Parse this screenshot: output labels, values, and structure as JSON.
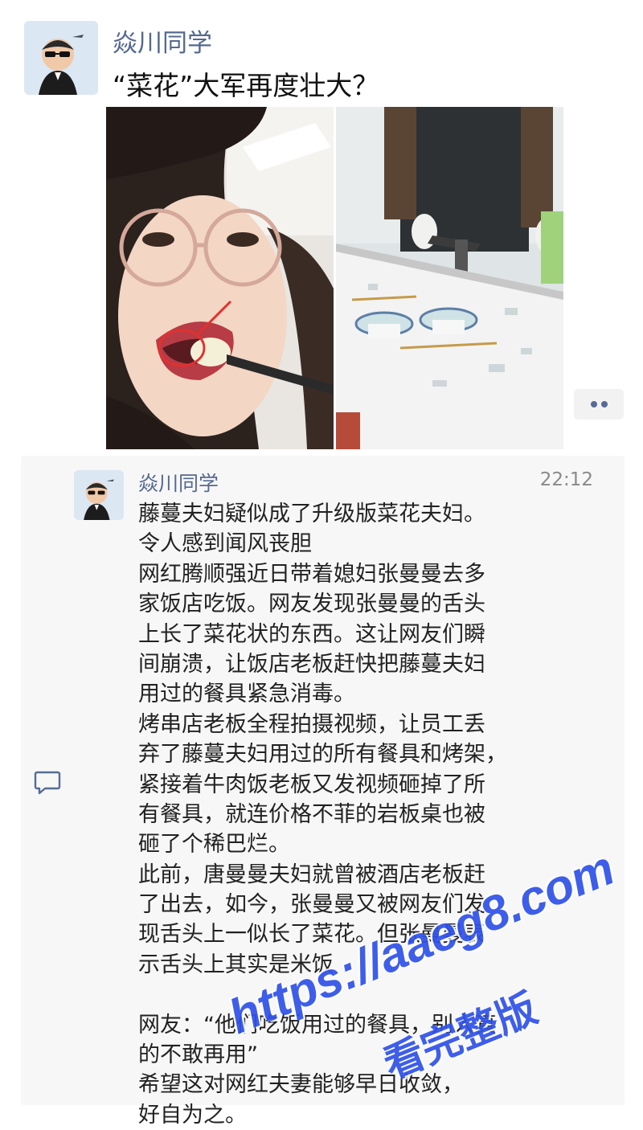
{
  "post": {
    "author": "焱川同学",
    "title": "“菜花”大军再度壮大？"
  },
  "photos": [
    {
      "icon": "woman-eating-photo"
    },
    {
      "icon": "smashed-table-photo"
    }
  ],
  "more_icon": "more-dots-icon",
  "comment": {
    "author": "焱川同学",
    "time": "22:12",
    "lines": [
      "藤蔓夫妇疑似成了升级版菜花夫妇。",
      "令人感到闻风丧胆",
      "网红腾顺强近日带着媳妇张曼曼去多",
      "家饭店吃饭。网友发现张曼曼的舌头",
      "上长了菜花状的东西。这让网友们瞬",
      "间崩溃，让饭店老板赶快把藤蔓夫妇",
      "用过的餐具紧急消毒。",
      "烤串店老板全程拍摄视频，让员工丢",
      "弃了藤蔓夫妇用过的所有餐具和烤架，",
      "紧接着牛肉饭老板又发视频砸掉了所",
      "有餐具，就连价格不菲的岩板桌也被",
      "砸了个稀巴烂。",
      "此前，唐曼曼夫妇就曾被酒店老板赶",
      "了出去，如今，张曼曼又被网友们发",
      "现舌头上一似长了菜花。但张曼曼表",
      "示舌头上其实是米饭",
      "",
      "网友：“他们吃饭用过的餐具，别人真",
      "的不敢再用”",
      "希望这对网红夫妻能够早日收敛，",
      "好自为之。"
    ]
  },
  "side_icon": "comment-bubble-icon",
  "watermark": {
    "url": "https://aaeg8.com",
    "caption": "看完整版"
  },
  "colors": {
    "name_blue": "#576b95",
    "panel_bg": "#f7f7f7",
    "watermark": "#2f52e8"
  }
}
